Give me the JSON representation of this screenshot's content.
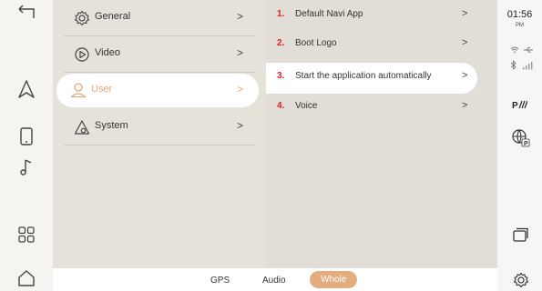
{
  "menu": {
    "items": [
      {
        "label": "General",
        "icon": "gear-icon",
        "chevron": ">"
      },
      {
        "label": "Video",
        "icon": "play-circle-icon",
        "chevron": ">"
      },
      {
        "label": "User",
        "icon": "user-icon",
        "chevron": ">",
        "active": true
      },
      {
        "label": "System",
        "icon": "system-settings-icon",
        "chevron": ">"
      }
    ]
  },
  "detail": {
    "items": [
      {
        "num": "1.",
        "label": "Default Navi App",
        "chevron": ">"
      },
      {
        "num": "2.",
        "label": "Boot Logo",
        "chevron": ">"
      },
      {
        "num": "3.",
        "label": "Start the application automatically",
        "chevron": ">",
        "selected": true
      },
      {
        "num": "4.",
        "label": "Voice",
        "chevron": ">"
      }
    ]
  },
  "bottom_tabs": [
    {
      "label": "GPS"
    },
    {
      "label": "Audio"
    },
    {
      "label": "Whole",
      "active": true
    }
  ],
  "status": {
    "time": "01:56",
    "ampm": "PM",
    "signal_text": "P"
  },
  "colors": {
    "accent": "#e4ad7e",
    "number_red": "#e02020",
    "panel_bg": "#e6e1d9"
  }
}
